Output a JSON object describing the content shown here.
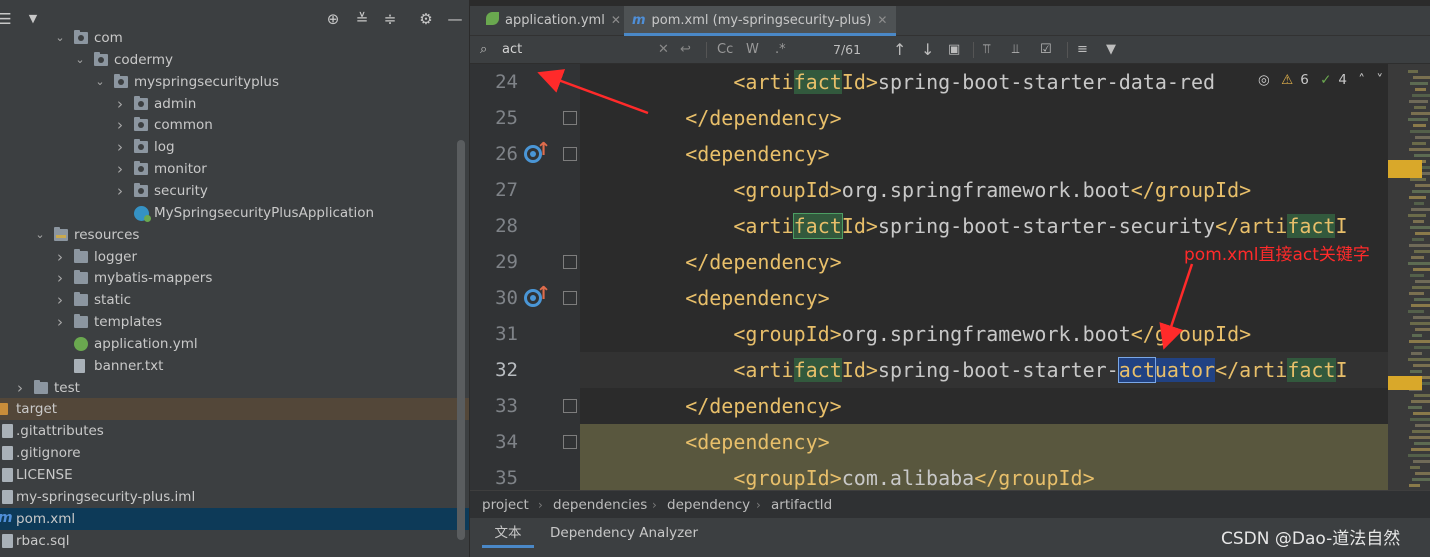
{
  "project_panel": {
    "tree": [
      {
        "label": "com",
        "depth": 2,
        "expand": "open",
        "icon": "package-folder"
      },
      {
        "label": "codermy",
        "depth": 3,
        "expand": "open",
        "icon": "package-folder"
      },
      {
        "label": "myspringsecurityplus",
        "depth": 4,
        "expand": "open",
        "icon": "package-folder"
      },
      {
        "label": "admin",
        "depth": 5,
        "expand": "closed",
        "icon": "package-folder"
      },
      {
        "label": "common",
        "depth": 5,
        "expand": "closed",
        "icon": "package-folder"
      },
      {
        "label": "log",
        "depth": 5,
        "expand": "closed",
        "icon": "package-folder"
      },
      {
        "label": "monitor",
        "depth": 5,
        "expand": "closed",
        "icon": "package-folder"
      },
      {
        "label": "security",
        "depth": 5,
        "expand": "closed",
        "icon": "package-folder"
      },
      {
        "label": "MySpringsecurityPlusApplication",
        "depth": 5,
        "expand": "none",
        "icon": "spring-boot-class"
      },
      {
        "label": "resources",
        "depth": 1,
        "expand": "open",
        "icon": "resources-folder"
      },
      {
        "label": "logger",
        "depth": 2,
        "expand": "closed",
        "icon": "folder"
      },
      {
        "label": "mybatis-mappers",
        "depth": 2,
        "expand": "closed",
        "icon": "folder"
      },
      {
        "label": "static",
        "depth": 2,
        "expand": "closed",
        "icon": "folder"
      },
      {
        "label": "templates",
        "depth": 2,
        "expand": "closed",
        "icon": "folder"
      },
      {
        "label": "application.yml",
        "depth": 2,
        "expand": "none",
        "icon": "spring-config-file"
      },
      {
        "label": "banner.txt",
        "depth": 2,
        "expand": "none",
        "icon": "text-file"
      },
      {
        "label": "test",
        "depth": 0,
        "expand": "closed",
        "icon": "folder"
      },
      {
        "label": "target",
        "depth": -1,
        "expand": "none",
        "icon": "excluded-folder",
        "state": "excluded"
      },
      {
        "label": ".gitattributes",
        "depth": -1,
        "expand": "none",
        "icon": "git-file"
      },
      {
        "label": ".gitignore",
        "depth": -1,
        "expand": "none",
        "icon": "git-file"
      },
      {
        "label": "LICENSE",
        "depth": -1,
        "expand": "none",
        "icon": "text-file"
      },
      {
        "label": "my-springsecurity-plus.iml",
        "depth": -1,
        "expand": "none",
        "icon": "module-file"
      },
      {
        "label": "pom.xml",
        "depth": -1,
        "expand": "none",
        "icon": "maven-file",
        "state": "selected"
      },
      {
        "label": "rbac.sql",
        "depth": -1,
        "expand": "none",
        "icon": "sql-file"
      }
    ]
  },
  "tabs": [
    {
      "label": "application.yml",
      "icon": "spring-leaf-icon",
      "active": false
    },
    {
      "label": "pom.xml (my-springsecurity-plus)",
      "icon": "maven-m-icon",
      "active": true
    }
  ],
  "find_bar": {
    "query": "act",
    "match_case": "Cc",
    "words": "W",
    "regex": ".*",
    "match_count": "7/61"
  },
  "editor": {
    "inline_stats": {
      "warnings": "6",
      "weak_warnings": "4"
    },
    "current_line": 32,
    "lines": [
      {
        "num": 24,
        "indent": 8,
        "segments": [
          [
            "tag",
            "<arti"
          ],
          [
            "hl",
            "fact"
          ],
          [
            "tag",
            "Id>"
          ],
          [
            "txt",
            "spring-boot-starter-data-red"
          ]
        ]
      },
      {
        "num": 25,
        "indent": 4,
        "segments": [
          [
            "tag",
            "</dependency>"
          ]
        ]
      },
      {
        "num": 26,
        "indent": 4,
        "segments": [
          [
            "tag",
            "<dependency>"
          ]
        ],
        "gutter": true
      },
      {
        "num": 27,
        "indent": 8,
        "segments": [
          [
            "tag",
            "<groupId>"
          ],
          [
            "txt",
            "org.springframework.boot"
          ],
          [
            "tag",
            "</groupId>"
          ]
        ]
      },
      {
        "num": 28,
        "indent": 8,
        "segments": [
          [
            "tag",
            "<arti"
          ],
          [
            "hlbox",
            "fact"
          ],
          [
            "tag",
            "Id>"
          ],
          [
            "txt",
            "spring-boot-starter-security"
          ],
          [
            "tag",
            "</arti"
          ],
          [
            "hl",
            "fact"
          ],
          [
            "tag",
            "I"
          ]
        ]
      },
      {
        "num": 29,
        "indent": 4,
        "segments": [
          [
            "tag",
            "</dependency>"
          ]
        ]
      },
      {
        "num": 30,
        "indent": 4,
        "segments": [
          [
            "tag",
            "<dependency>"
          ]
        ],
        "gutter": true
      },
      {
        "num": 31,
        "indent": 8,
        "segments": [
          [
            "tag",
            "<groupId>"
          ],
          [
            "txt",
            "org.springframework.boot"
          ],
          [
            "tag",
            "</groupId>"
          ]
        ]
      },
      {
        "num": 32,
        "indent": 8,
        "segments": [
          [
            "tag",
            "<arti"
          ],
          [
            "hl",
            "fact"
          ],
          [
            "tag",
            "Id>"
          ],
          [
            "txt",
            "spring-boot-starter-"
          ],
          [
            "selbox",
            "act"
          ],
          [
            "sel",
            "uator"
          ],
          [
            "tag",
            "</arti"
          ],
          [
            "hl",
            "fact"
          ],
          [
            "tag",
            "I"
          ]
        ]
      },
      {
        "num": 33,
        "indent": 4,
        "segments": [
          [
            "tag",
            "</dependency>"
          ]
        ]
      },
      {
        "num": 34,
        "indent": 4,
        "segments": [
          [
            "tag",
            "<dependency>"
          ]
        ],
        "warm": true
      },
      {
        "num": 35,
        "indent": 8,
        "segments": [
          [
            "tag",
            "<groupId>"
          ],
          [
            "txt",
            "com.alibaba"
          ],
          [
            "tag",
            "</groupId>"
          ]
        ],
        "warm": true
      }
    ]
  },
  "annotation": "pom.xml直接act关键字",
  "breadcrumb": [
    "project",
    "dependencies",
    "dependency",
    "artifactId"
  ],
  "bottom_tabs": [
    {
      "label": "文本",
      "active": true
    },
    {
      "label": "Dependency Analyzer",
      "active": false
    }
  ],
  "watermark": "CSDN @Dao-道法自然",
  "colors": {
    "tag": "#e8bf6a",
    "text": "#c8c8c8",
    "match_highlight": "#32593d",
    "selection": "#214283",
    "annotation": "#ff2a2a",
    "accent": "#4a88c7"
  }
}
